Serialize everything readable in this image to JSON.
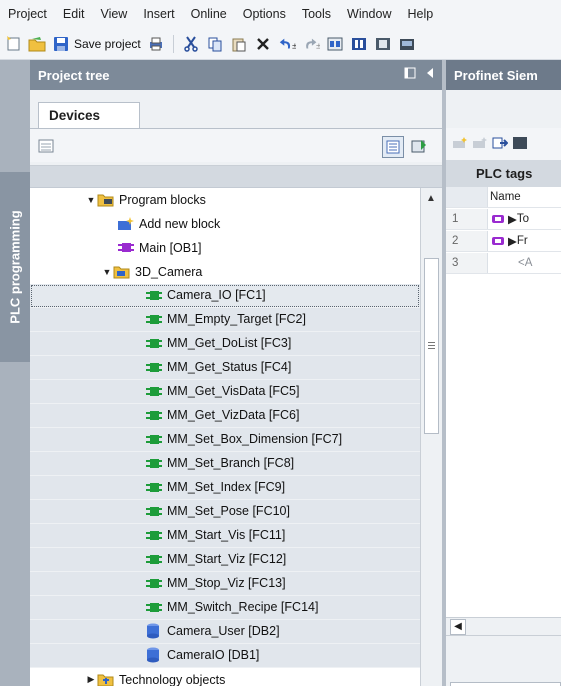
{
  "menu": [
    "Project",
    "Edit",
    "View",
    "Insert",
    "Online",
    "Options",
    "Tools",
    "Window",
    "Help"
  ],
  "toolbar": {
    "save_label": "Save project"
  },
  "sidebar_strip": {
    "label": "PLC programming"
  },
  "project_tree": {
    "title": "Project tree",
    "tab": "Devices",
    "rows": [
      {
        "label": "Program blocks",
        "indent": 1,
        "expanded": true,
        "icon": "folder-blocks-icon"
      },
      {
        "label": "Add new block",
        "indent": 2,
        "icon": "add-block-icon"
      },
      {
        "label": "Main [OB1]",
        "indent": 2,
        "icon": "ob-icon"
      },
      {
        "label": "3D_Camera",
        "indent": 2,
        "expanded": true,
        "icon": "folder-icon"
      },
      {
        "label": "Camera_IO [FC1]",
        "indent": 3,
        "icon": "fc-icon",
        "selected": true
      },
      {
        "label": "MM_Empty_Target [FC2]",
        "indent": 3,
        "icon": "fc-icon"
      },
      {
        "label": "MM_Get_DoList [FC3]",
        "indent": 3,
        "icon": "fc-icon"
      },
      {
        "label": "MM_Get_Status [FC4]",
        "indent": 3,
        "icon": "fc-icon"
      },
      {
        "label": "MM_Get_VisData [FC5]",
        "indent": 3,
        "icon": "fc-icon"
      },
      {
        "label": "MM_Get_VizData [FC6]",
        "indent": 3,
        "icon": "fc-icon"
      },
      {
        "label": "MM_Set_Box_Dimension [FC7]",
        "indent": 3,
        "icon": "fc-icon"
      },
      {
        "label": "MM_Set_Branch [FC8]",
        "indent": 3,
        "icon": "fc-icon"
      },
      {
        "label": "MM_Set_Index [FC9]",
        "indent": 3,
        "icon": "fc-icon"
      },
      {
        "label": "MM_Set_Pose [FC10]",
        "indent": 3,
        "icon": "fc-icon"
      },
      {
        "label": "MM_Start_Vis [FC11]",
        "indent": 3,
        "icon": "fc-icon"
      },
      {
        "label": "MM_Start_Viz [FC12]",
        "indent": 3,
        "icon": "fc-icon"
      },
      {
        "label": "MM_Stop_Viz [FC13]",
        "indent": 3,
        "icon": "fc-icon"
      },
      {
        "label": "MM_Switch_Recipe [FC14]",
        "indent": 3,
        "icon": "fc-icon"
      },
      {
        "label": "Camera_User [DB2]",
        "indent": 3,
        "icon": "db-icon"
      },
      {
        "label": "CameraIO [DB1]",
        "indent": 3,
        "icon": "db-icon"
      },
      {
        "label": "Technology objects",
        "indent": 1,
        "expanded": false,
        "icon": "technology-folder-icon"
      }
    ]
  },
  "editor": {
    "title": "Profinet Siem",
    "section": "PLC tags",
    "column_name": "Name",
    "rows": [
      {
        "num": "1",
        "text": "To"
      },
      {
        "num": "2",
        "text": "Fr"
      },
      {
        "num": "3",
        "text": "<A"
      }
    ]
  },
  "colors": {
    "fc_green": "#1d9c3a",
    "db_blue": "#3d6fd6",
    "ob_purple": "#9a2bd0",
    "panel_header": "#7d8a99"
  }
}
